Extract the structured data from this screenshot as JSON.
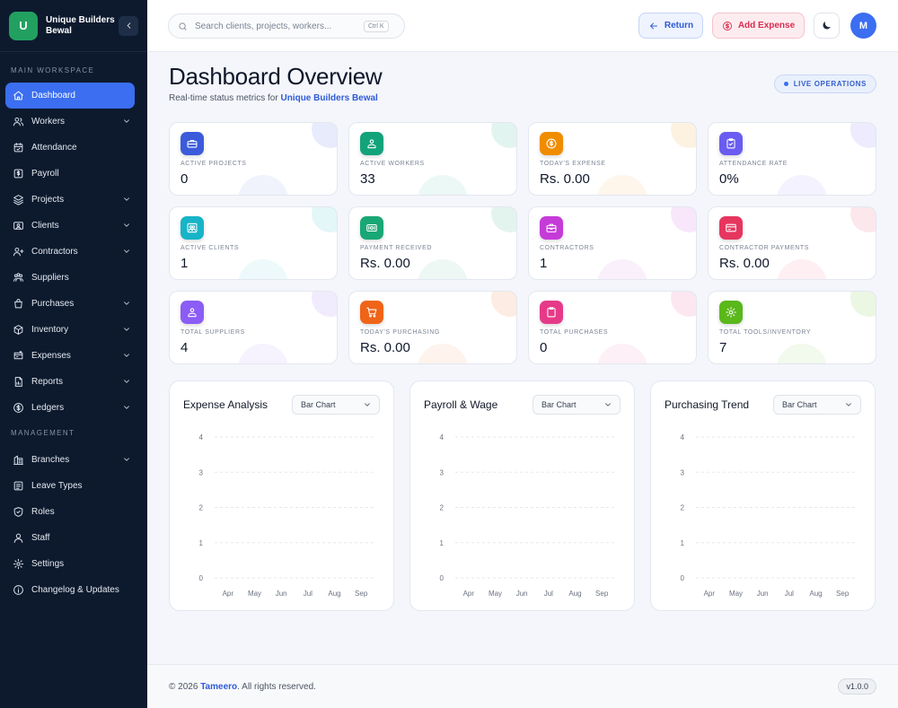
{
  "brand": {
    "initial": "U",
    "name": "Unique Builders Bewal"
  },
  "sidebar": {
    "main_label": "MAIN WORKSPACE",
    "main_items": [
      {
        "label": "Dashboard",
        "icon": "home-icon",
        "active": true,
        "has_children": false
      },
      {
        "label": "Workers",
        "icon": "users-icon",
        "has_children": true
      },
      {
        "label": "Attendance",
        "icon": "calendar-check-icon",
        "has_children": false
      },
      {
        "label": "Payroll",
        "icon": "payroll-icon",
        "has_children": false
      },
      {
        "label": "Projects",
        "icon": "layers-icon",
        "has_children": true
      },
      {
        "label": "Clients",
        "icon": "client-card-icon",
        "has_children": true
      },
      {
        "label": "Contractors",
        "icon": "user-plus-icon",
        "has_children": true
      },
      {
        "label": "Suppliers",
        "icon": "suppliers-icon",
        "has_children": false
      },
      {
        "label": "Purchases",
        "icon": "shopping-bag-icon",
        "has_children": true
      },
      {
        "label": "Inventory",
        "icon": "box-icon",
        "has_children": true
      },
      {
        "label": "Expenses",
        "icon": "expense-icon",
        "has_children": true
      },
      {
        "label": "Reports",
        "icon": "report-icon",
        "has_children": true
      },
      {
        "label": "Ledgers",
        "icon": "dollar-circle-icon",
        "has_children": true
      }
    ],
    "management_label": "MANAGEMENT",
    "management_items": [
      {
        "label": "Branches",
        "icon": "building-icon",
        "has_children": true
      },
      {
        "label": "Leave Types",
        "icon": "list-icon",
        "has_children": false
      },
      {
        "label": "Roles",
        "icon": "shield-icon",
        "has_children": false
      },
      {
        "label": "Staff",
        "icon": "staff-icon",
        "has_children": false
      },
      {
        "label": "Settings",
        "icon": "settings-icon",
        "has_children": false
      },
      {
        "label": "Changelog & Updates",
        "icon": "info-icon",
        "has_children": false
      }
    ]
  },
  "topbar": {
    "search_placeholder": "Search clients, projects, workers...",
    "search_shortcut": "Ctrl K",
    "return_label": "Return",
    "add_expense_label": "Add Expense",
    "avatar_initial": "M"
  },
  "header": {
    "title": "Dashboard Overview",
    "subtitle_prefix": "Real-time status metrics for",
    "subtitle_company": "Unique Builders Bewal",
    "live_badge": "LIVE OPERATIONS"
  },
  "stats": [
    {
      "label": "ACTIVE PROJECTS",
      "value": "0",
      "color": "#3b5bdb",
      "icon": "briefcase-icon"
    },
    {
      "label": "ACTIVE WORKERS",
      "value": "33",
      "color": "#12a37a",
      "icon": "worker-icon"
    },
    {
      "label": "TODAY'S EXPENSE",
      "value": "Rs. 0.00",
      "color": "#f08c00",
      "icon": "coin-icon"
    },
    {
      "label": "ATTENDANCE RATE",
      "value": "0%",
      "color": "#6a5cf0",
      "icon": "clipboard-check-icon"
    },
    {
      "label": "ACTIVE CLIENTS",
      "value": "1",
      "color": "#17b4c8",
      "icon": "clients-icon"
    },
    {
      "label": "PAYMENT RECEIVED",
      "value": "Rs. 0.00",
      "color": "#1aa776",
      "icon": "cash-icon"
    },
    {
      "label": "CONTRACTORS",
      "value": "1",
      "color": "#c53bd8",
      "icon": "toolbox-icon"
    },
    {
      "label": "CONTRACTOR PAYMENTS",
      "value": "Rs. 0.00",
      "color": "#e6365f",
      "icon": "credit-card-icon"
    },
    {
      "label": "TOTAL SUPPLIERS",
      "value": "4",
      "color": "#8b5cf6",
      "icon": "supplier-icon"
    },
    {
      "label": "TODAY'S PURCHASING",
      "value": "Rs. 0.00",
      "color": "#f06418",
      "icon": "cart-icon"
    },
    {
      "label": "TOTAL PURCHASES",
      "value": "0",
      "color": "#e63a88",
      "icon": "clipboard-icon"
    },
    {
      "label": "TOTAL TOOLS/INVENTORY",
      "value": "7",
      "color": "#5ab81a",
      "icon": "gear-icon"
    }
  ],
  "charts": {
    "select_value": "Bar Chart",
    "titles": [
      "Expense Analysis",
      "Payroll & Wage",
      "Purchasing Trend"
    ]
  },
  "chart_data": [
    {
      "type": "bar",
      "title": "Expense Analysis",
      "categories": [
        "Apr",
        "May",
        "Jun",
        "Jul",
        "Aug",
        "Sep"
      ],
      "values": [
        0,
        0,
        0,
        0,
        0,
        0
      ],
      "ylim": [
        0,
        4
      ],
      "yticks": [
        0,
        1,
        2,
        3,
        4
      ],
      "grid": true
    },
    {
      "type": "bar",
      "title": "Payroll & Wage",
      "categories": [
        "Apr",
        "May",
        "Jun",
        "Jul",
        "Aug",
        "Sep"
      ],
      "values": [
        0,
        0,
        0,
        0,
        0,
        0
      ],
      "ylim": [
        0,
        4
      ],
      "yticks": [
        0,
        1,
        2,
        3,
        4
      ],
      "grid": true
    },
    {
      "type": "bar",
      "title": "Purchasing Trend",
      "categories": [
        "Apr",
        "May",
        "Jun",
        "Jul",
        "Aug",
        "Sep"
      ],
      "values": [
        0,
        0,
        0,
        0,
        0,
        0
      ],
      "ylim": [
        0,
        4
      ],
      "yticks": [
        0,
        1,
        2,
        3,
        4
      ],
      "grid": true
    }
  ],
  "footer": {
    "copyright_prefix": "© 2026",
    "company": "Tameero",
    "copyright_suffix": ". All rights reserved.",
    "version": "v1.0.0"
  },
  "colors": {
    "sidebar_bg": "#0d1a2e",
    "accent": "#3b6ef0",
    "danger": "#d92d50",
    "brand_logo": "#22a060"
  }
}
